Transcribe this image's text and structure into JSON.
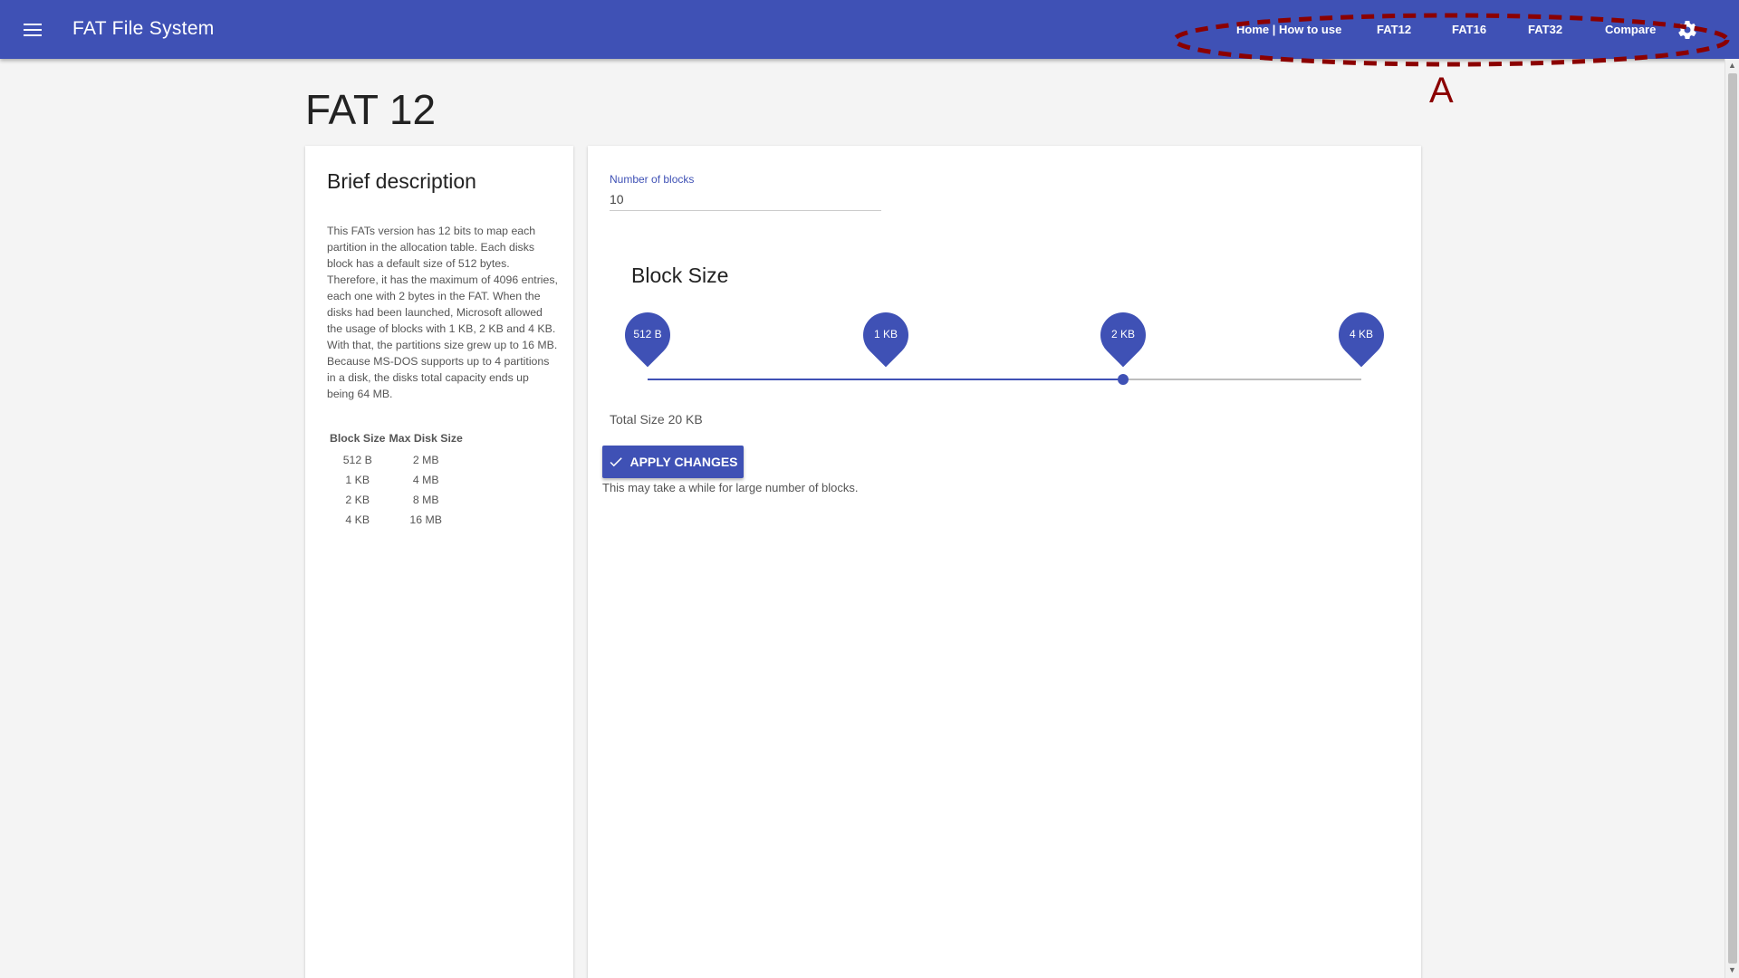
{
  "header": {
    "app_title": "FAT File System",
    "nav": [
      "Home | How to use",
      "FAT12",
      "FAT16",
      "FAT32",
      "Compare"
    ],
    "menu_icon": "menu-icon",
    "settings_icon": "gear-icon"
  },
  "annotation": {
    "label": "A",
    "color": "#8b0000"
  },
  "page": {
    "title": "FAT 12"
  },
  "description": {
    "heading": "Brief description",
    "text": "This FATs version has 12 bits to map each partition in the allocation table. Each disks block has a default size of 512 bytes. Therefore, it has the maximum of 4096 entries, each one with 2 bytes in the FAT. When the disks had been launched, Microsoft allowed the usage of blocks with 1 KB, 2 KB and 4 KB. With that, the partitions size grew up to 16 MB. Because MS-DOS supports up to 4 partitions in a disk, the disks total capacity ends up being 64 MB.",
    "table": {
      "headers": [
        "Block Size",
        "Max Disk Size"
      ],
      "rows": [
        [
          "512 B",
          "2 MB"
        ],
        [
          "1 KB",
          "4 MB"
        ],
        [
          "2 KB",
          "8 MB"
        ],
        [
          "4 KB",
          "16 MB"
        ]
      ]
    }
  },
  "form": {
    "blocks_label": "Number of blocks",
    "blocks_value": "10",
    "block_size_heading": "Block Size",
    "slider": {
      "stops": [
        "512 B",
        "1 KB",
        "2 KB",
        "4 KB"
      ],
      "selected_index": 2
    },
    "total_size": "Total Size 20 KB",
    "apply_label": "APPLY CHANGES",
    "apply_icon": "check-icon",
    "apply_hint": "This may take a while for large number of blocks."
  },
  "colors": {
    "primary": "#3f51b5",
    "annotation": "#8b0000"
  }
}
